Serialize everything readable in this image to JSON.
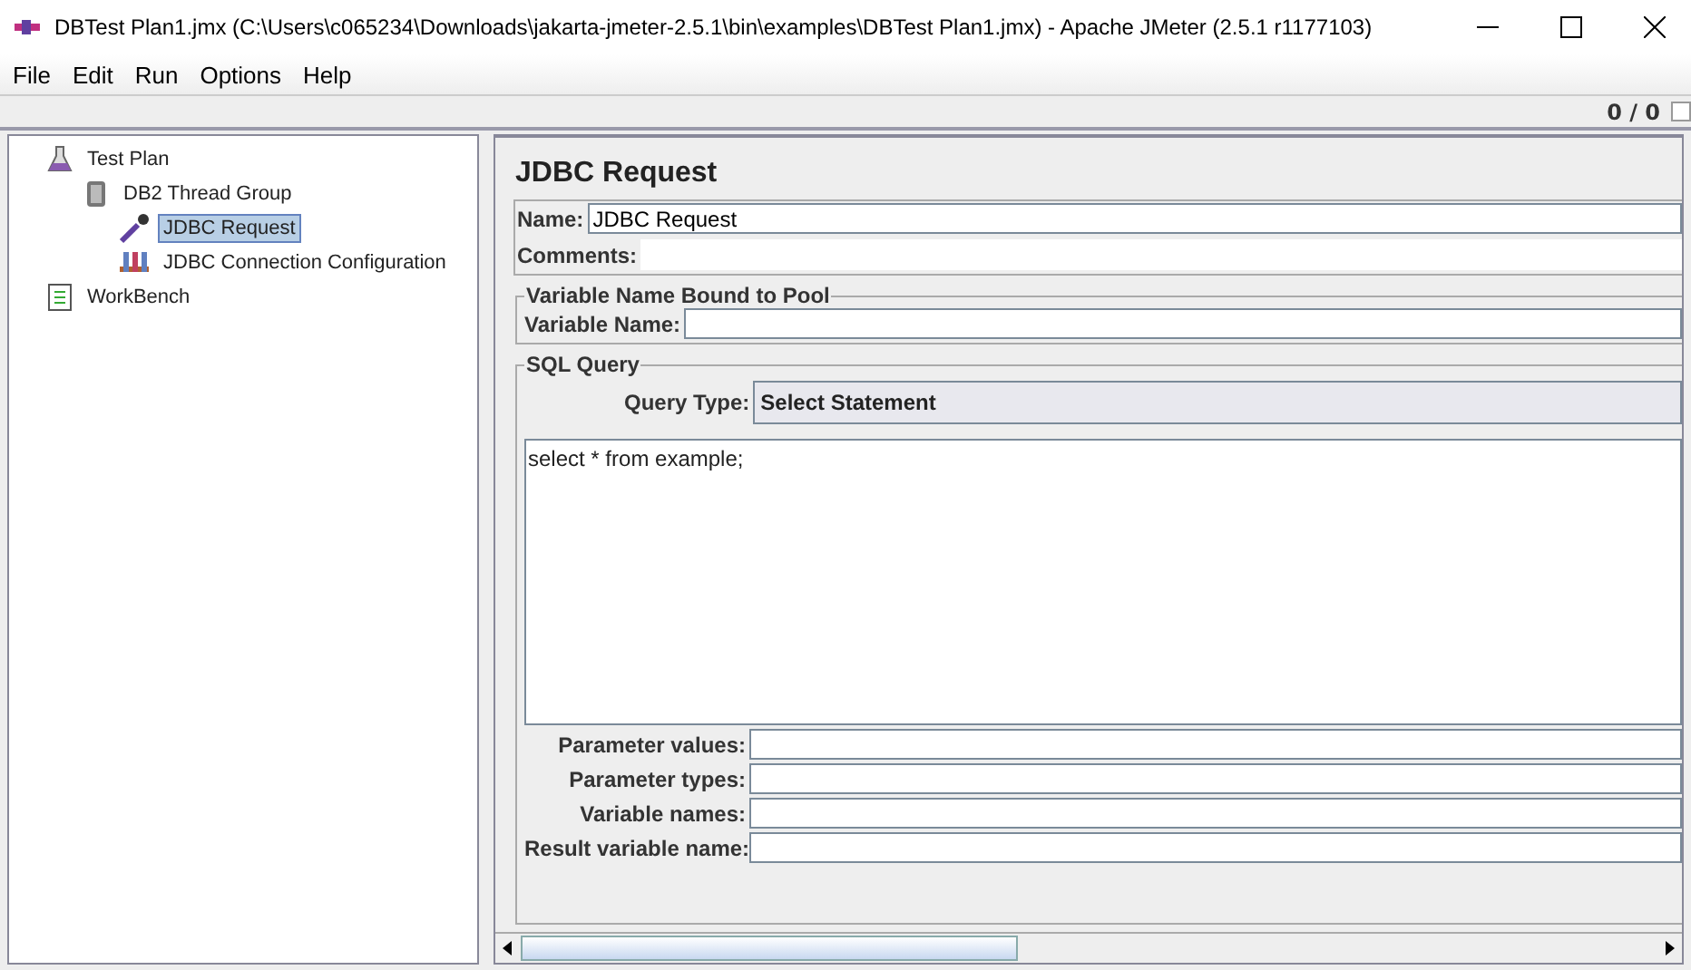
{
  "window": {
    "title": "DBTest Plan1.jmx (C:\\Users\\c065234\\Downloads\\jakarta-jmeter-2.5.1\\bin\\examples\\DBTest Plan1.jmx) - Apache JMeter (2.5.1 r1177103)"
  },
  "menu": [
    "File",
    "Edit",
    "Run",
    "Options",
    "Help"
  ],
  "toolbar": {
    "counter": "0 / 0"
  },
  "tree": [
    {
      "label": "Test Plan",
      "kind": "plan",
      "selected": false,
      "children": [
        {
          "label": "DB2 Thread Group",
          "kind": "threads",
          "selected": false,
          "children": [
            {
              "label": "JDBC Request",
              "kind": "sampler",
              "selected": true
            },
            {
              "label": "JDBC Connection Configuration",
              "kind": "config",
              "selected": false
            }
          ]
        }
      ]
    },
    {
      "label": "WorkBench",
      "kind": "workbench",
      "selected": false
    }
  ],
  "panel": {
    "title": "JDBC Request",
    "name_label": "Name:",
    "name_value": "JDBC Request",
    "comments_label": "Comments:",
    "pool_group": {
      "title": "Variable Name Bound to Pool",
      "label": "Variable Name:"
    },
    "sql_group": {
      "title": "SQL Query",
      "query_type_label": "Query Type:",
      "query_type": "Select Statement",
      "query": "select * from example;",
      "fields": [
        {
          "label": "Parameter values:"
        },
        {
          "label": "Parameter types:"
        },
        {
          "label": "Variable names:"
        },
        {
          "label": "Result variable name:"
        }
      ]
    }
  }
}
